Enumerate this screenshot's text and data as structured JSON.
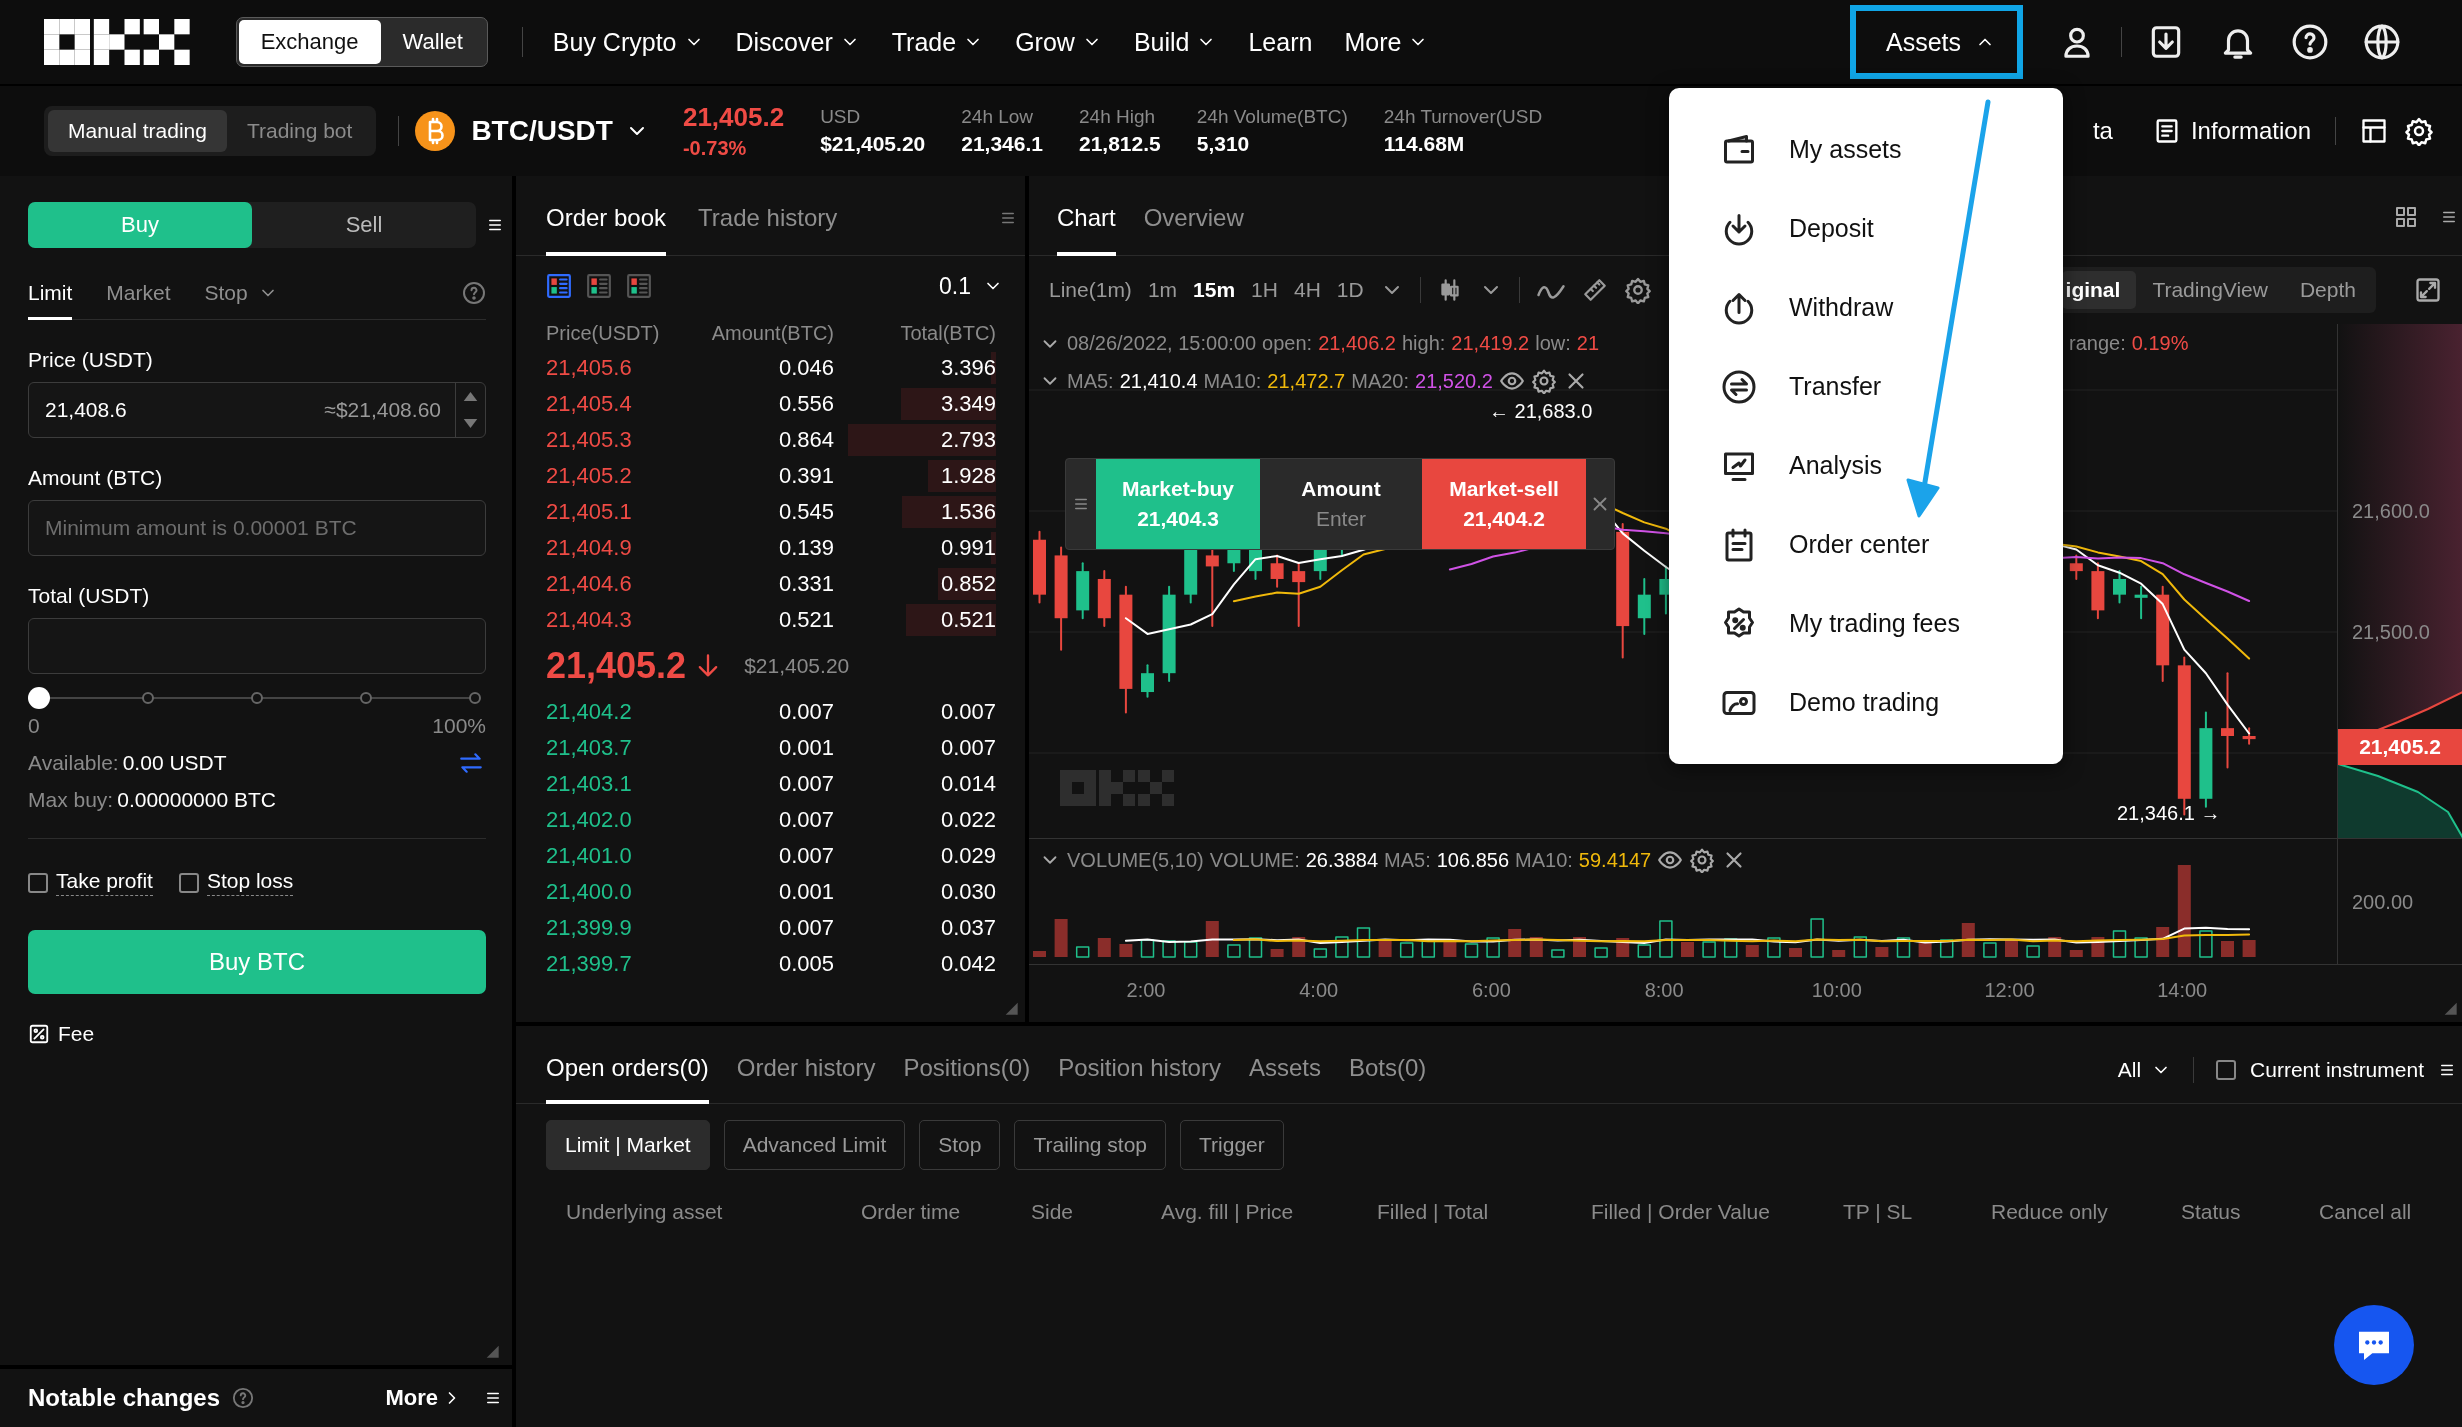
{
  "nav": {
    "mode_tabs": [
      {
        "label": "Exchange",
        "selected": true
      },
      {
        "label": "Wallet",
        "selected": false
      }
    ],
    "menu": [
      {
        "label": "Buy Crypto",
        "dropdown": true
      },
      {
        "label": "Discover",
        "dropdown": true
      },
      {
        "label": "Trade",
        "dropdown": true
      },
      {
        "label": "Grow",
        "dropdown": true
      },
      {
        "label": "Build",
        "dropdown": true
      },
      {
        "label": "Learn",
        "dropdown": false
      },
      {
        "label": "More",
        "dropdown": true
      }
    ],
    "assets": {
      "label": "Assets",
      "expanded": true,
      "highlighted": true
    }
  },
  "ticker": {
    "trade_tabs": [
      {
        "label": "Manual trading",
        "selected": true
      },
      {
        "label": "Trading bot",
        "selected": false
      }
    ],
    "pair": "BTC/USDT",
    "price": "21,405.2",
    "change": "-0.73%",
    "stats": [
      {
        "label": "USD",
        "value": "$21,405.20"
      },
      {
        "label": "24h Low",
        "value": "21,346.1"
      },
      {
        "label": "24h High",
        "value": "21,812.5"
      },
      {
        "label": "24h Volume(BTC)",
        "value": "5,310"
      },
      {
        "label": "24h Turnover(USD",
        "value": "114.68M"
      }
    ],
    "cut_link": "ta",
    "information": "Information"
  },
  "trade_form": {
    "side_tabs": [
      {
        "label": "Buy",
        "selected": true
      },
      {
        "label": "Sell",
        "selected": false
      }
    ],
    "order_types": [
      {
        "label": "Limit",
        "selected": true,
        "dropdown": false
      },
      {
        "label": "Market",
        "selected": false,
        "dropdown": false
      },
      {
        "label": "Stop",
        "selected": false,
        "dropdown": true
      }
    ],
    "price_label": "Price (USDT)",
    "price_value": "21,408.6",
    "price_usd": "≈$21,408.60",
    "amount_label": "Amount (BTC)",
    "amount_placeholder": "Minimum amount is 0.00001 BTC",
    "total_label": "Total (USDT)",
    "slider": {
      "level": 0,
      "min_label": "0",
      "max_label": "100%"
    },
    "available_label": "Available:",
    "available_value": "0.00 USDT",
    "max_buy_label": "Max buy:",
    "max_buy_value": "0.00000000 BTC",
    "options": [
      {
        "label": "Take profit",
        "checked": false
      },
      {
        "label": "Stop loss",
        "checked": false
      }
    ],
    "submit": "Buy BTC",
    "fee": "Fee",
    "notable": {
      "title": "Notable changes",
      "more": "More"
    }
  },
  "order_book": {
    "tabs": [
      {
        "label": "Order book",
        "selected": true
      },
      {
        "label": "Trade history",
        "selected": false
      }
    ],
    "views": [
      {
        "selected": true
      },
      {
        "selected": false
      },
      {
        "selected": false
      }
    ],
    "precision": "0.1",
    "columns": [
      "Price(USDT)",
      "Amount(BTC)",
      "Total(BTC)"
    ],
    "asks": [
      {
        "price": "21,405.6",
        "amount": "0.046",
        "total": "3.396"
      },
      {
        "price": "21,405.4",
        "amount": "0.556",
        "total": "3.349"
      },
      {
        "price": "21,405.3",
        "amount": "0.864",
        "total": "2.793"
      },
      {
        "price": "21,405.2",
        "amount": "0.391",
        "total": "1.928"
      },
      {
        "price": "21,405.1",
        "amount": "0.545",
        "total": "1.536"
      },
      {
        "price": "21,404.9",
        "amount": "0.139",
        "total": "0.991"
      },
      {
        "price": "21,404.6",
        "amount": "0.331",
        "total": "0.852"
      },
      {
        "price": "21,404.3",
        "amount": "0.521",
        "total": "0.521"
      }
    ],
    "last": {
      "price": "21,405.2",
      "usd": "$21,405.20"
    },
    "bids": [
      {
        "price": "21,404.2",
        "amount": "0.007",
        "total": "0.007"
      },
      {
        "price": "21,403.7",
        "amount": "0.001",
        "total": "0.007"
      },
      {
        "price": "21,403.1",
        "amount": "0.007",
        "total": "0.014"
      },
      {
        "price": "21,402.0",
        "amount": "0.007",
        "total": "0.022"
      },
      {
        "price": "21,401.0",
        "amount": "0.007",
        "total": "0.029"
      },
      {
        "price": "21,400.0",
        "amount": "0.001",
        "total": "0.030"
      },
      {
        "price": "21,399.9",
        "amount": "0.007",
        "total": "0.037"
      },
      {
        "price": "21,399.7",
        "amount": "0.005",
        "total": "0.042"
      }
    ]
  },
  "chart": {
    "tabs": [
      {
        "label": "Chart",
        "selected": true
      },
      {
        "label": "Overview",
        "selected": false
      }
    ],
    "intervals": [
      {
        "label": "Line(1m)",
        "selected": false
      },
      {
        "label": "1m",
        "selected": false
      },
      {
        "label": "15m",
        "selected": true
      },
      {
        "label": "1H",
        "selected": false
      },
      {
        "label": "4H",
        "selected": false
      },
      {
        "label": "1D",
        "selected": false
      }
    ],
    "views": [
      {
        "label": "iginal",
        "selected": true
      },
      {
        "label": "TradingView",
        "selected": false
      },
      {
        "label": "Depth",
        "selected": false
      }
    ],
    "candle_info": {
      "time": "08/26/2022, 15:00:00",
      "fields": [
        {
          "label": "open:",
          "value": "21,406.2"
        },
        {
          "label": "high:",
          "value": "21,419.2"
        },
        {
          "label": "low:",
          "value": "21"
        }
      ],
      "range_label": "range:",
      "range_value": "0.19%"
    },
    "ma": [
      {
        "label": "MA5:",
        "value": "21,410.4",
        "color": "#ffffff"
      },
      {
        "label": "MA10:",
        "value": "21,472.7",
        "color": "#f0b90b"
      },
      {
        "label": "MA20:",
        "value": "21,520.2",
        "color": "#d052e6"
      }
    ],
    "high_marker": "← 21,683.0",
    "low_marker": "21,346.1 →",
    "quick_trade": {
      "buy_label": "Market-buy",
      "buy_price": "21,404.3",
      "amount_label": "Amount",
      "amount_placeholder": "Enter",
      "sell_label": "Market-sell",
      "sell_price": "21,404.2"
    },
    "price_axis": [
      "21,600.0",
      "21,500.0"
    ],
    "last_price": "21,405.2",
    "volume": {
      "title": "VOLUME(5,10)",
      "fields": [
        {
          "label": "VOLUME:",
          "value": "26.3884",
          "color": "#ffffff"
        },
        {
          "label": "MA5:",
          "value": "106.856",
          "color": "#ffffff"
        },
        {
          "label": "MA10:",
          "value": "59.4147",
          "color": "#f0b90b"
        }
      ],
      "axis": "200.00"
    },
    "time_axis": [
      "2:00",
      "4:00",
      "6:00",
      "8:00",
      "10:00",
      "12:00",
      "14:00"
    ]
  },
  "orders": {
    "tabs": [
      {
        "label": "Open orders(0)",
        "selected": true
      },
      {
        "label": "Order history",
        "selected": false
      },
      {
        "label": "Positions(0)",
        "selected": false
      },
      {
        "label": "Position history",
        "selected": false
      },
      {
        "label": "Assets",
        "selected": false
      },
      {
        "label": "Bots(0)",
        "selected": false
      }
    ],
    "filter": "All",
    "current_instrument": {
      "label": "Current instrument",
      "checked": false
    },
    "order_types": [
      {
        "label": "Limit | Market",
        "selected": true
      },
      {
        "label": "Advanced Limit",
        "selected": false
      },
      {
        "label": "Stop",
        "selected": false
      },
      {
        "label": "Trailing stop",
        "selected": false
      },
      {
        "label": "Trigger",
        "selected": false
      }
    ],
    "columns": [
      "Underlying asset",
      "Order time",
      "Side",
      "Avg. fill | Price",
      "Filled | Total",
      "Filled | Order Value",
      "TP | SL",
      "Reduce only",
      "Status",
      "Cancel all"
    ]
  },
  "assets_menu": {
    "items": [
      "My assets",
      "Deposit",
      "Withdraw",
      "Transfer",
      "Analysis",
      "Order center",
      "My trading fees",
      "Demo trading"
    ]
  }
}
